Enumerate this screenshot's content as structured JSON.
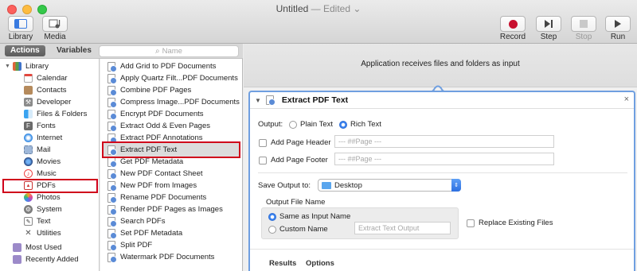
{
  "window": {
    "title": "Untitled",
    "edited": "— Edited ⌄"
  },
  "toolbar": {
    "library_label": "Library",
    "media_label": "Media",
    "record_label": "Record",
    "step_label": "Step",
    "stop_label": "Stop",
    "run_label": "Run"
  },
  "tabs": {
    "actions": "Actions",
    "variables": "Variables"
  },
  "search": {
    "placeholder": "Name"
  },
  "library": {
    "root": "Library",
    "items": [
      "Calendar",
      "Contacts",
      "Developer",
      "Files & Folders",
      "Fonts",
      "Internet",
      "Mail",
      "Movies",
      "Music",
      "PDFs",
      "Photos",
      "System",
      "Text",
      "Utilities"
    ],
    "smart": [
      "Most Used",
      "Recently Added"
    ]
  },
  "actions": [
    "Add Grid to PDF Documents",
    "Apply Quartz Filt...PDF Documents",
    "Combine PDF Pages",
    "Compress Image...PDF Documents",
    "Encrypt PDF Documents",
    "Extract Odd & Even Pages",
    "Extract PDF Annotations",
    "Extract PDF Text",
    "Get PDF Metadata",
    "New PDF Contact Sheet",
    "New PDF from Images",
    "Rename PDF Documents",
    "Render PDF Pages as Images",
    "Search PDFs",
    "Set PDF Metadata",
    "Split PDF",
    "Watermark PDF Documents"
  ],
  "workflow": {
    "receives": "Application receives files and folders as input",
    "card": {
      "title": "Extract PDF Text",
      "output_label": "Output:",
      "plain_text": "Plain Text",
      "rich_text": "Rich Text",
      "add_page_header": "Add Page Header",
      "add_page_footer": "Add Page Footer",
      "header_placeholder": "--- ##Page ---",
      "footer_placeholder": "--- ##Page ---",
      "save_output_to": "Save Output to:",
      "save_location": "Desktop",
      "output_file_name": "Output File Name",
      "same_as_input": "Same as Input Name",
      "custom_name": "Custom Name",
      "custom_placeholder": "Extract Text Output",
      "replace_existing": "Replace Existing Files",
      "results_tab": "Results",
      "options_tab": "Options"
    }
  },
  "colors": {
    "highlight_box": "#d0021b",
    "card_border": "#6f9fe0",
    "accent_blue": "#3b83f0",
    "record_red": "#d0021b"
  }
}
